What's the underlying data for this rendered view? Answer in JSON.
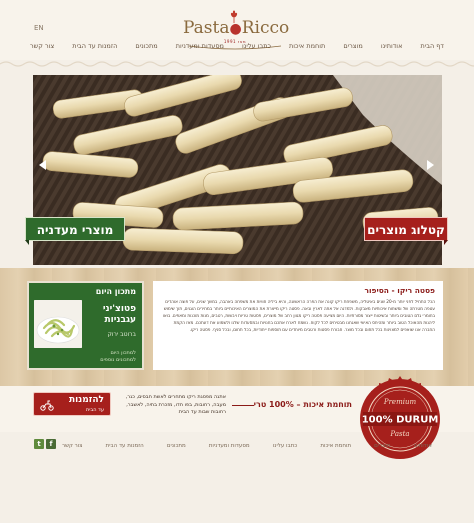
{
  "header": {
    "lang": "EN",
    "logo": {
      "name_left": "Pasta",
      "name_right": "Ricco",
      "since": "1991 מאז"
    }
  },
  "nav": {
    "items": [
      "דף הבית",
      "אודותינו",
      "מוצרים",
      "תוחמת איכות",
      "כתבו עלינו",
      "מסעדות ומעדניות",
      "מתכונים",
      "הזמנות עד הבית",
      "צור קשר"
    ]
  },
  "hero": {
    "left_label": "מוצרי מעדניה",
    "right_label": "קטלוג מוצרים"
  },
  "recipe": {
    "title": "מתכון היום",
    "dish": "פטוצ'יני עגבניות",
    "sub": "ברוטב ירוק",
    "link1": "למתכון היום",
    "link2": "למתכונים נוספים"
  },
  "story": {
    "title": "פסטה ריקו - הסיפור",
    "body": "הכל התחיל לפני יותר מ-20 שנים באיטליה, משפחת ריקו קונה את הפרה הראשונה, והיא ביליה חוויות את משפחה באהבה, במשך שנים, על פוצה אוהדים עטפה מטרתה של ומשחות איכותיות מאבקות. ולמדנה אל אתה לארץ ובאה. פסטה ריקו מייצרת את המוצרים האיכותיים ביותר במחירים הוגנים, תוך שימוש בחומרי גלם הטובים ביותר ובשיטות ייצור מסורתיות. היום מציעה פסטה ריקו מגוון רחב של מוצרים, פסטות טריות ויבשות, רטבים, מנות מוכנות ומאפים. בואו ליהנות מהאוכל הטוב ביותר ומהיחס האישי שאנחנו מבטיחים לכל לקוח. נשמח לארח אתכם בחנויות ובמסעדות שלנו ולשמוע את דעתכם. מאז הקמת החברה אנו שואפים למצוינות בכל תחום ובכל מוצר. חבורת פסטות ורטבים מיוחדים עם תוספות ייחודיות, בכל תחום, ובכל סניף. פסטה ריקו."
  },
  "order": {
    "big": "להזמנות",
    "small": "עד הבית",
    "text": "אתגה מפסגת ריקו מתחרים לאשת חבסים, כגר, מעבה, רחובות, בפו חדו, מזכרת בתיה, לאשבר, רחובות שבות עד הבית"
  },
  "durum": {
    "title": "תוחמת איכות – 100% טרי",
    "seal_top": "Premium",
    "seal_main": "100% DURUM",
    "seal_bottom": "Pasta"
  },
  "footer": {
    "items": [
      "אודותינו",
      "מוצרים",
      "תוחמת איכות",
      "כתבו עלינו",
      "מסעדות ומעדניות",
      "מתכונים",
      "הזמנות עד הבית",
      "צור קשר"
    ],
    "twitter": "t",
    "facebook": "f"
  },
  "colors": {
    "green": "#2f6b2c",
    "red": "#a6201c",
    "brand_gold": "#8a6a3e"
  }
}
